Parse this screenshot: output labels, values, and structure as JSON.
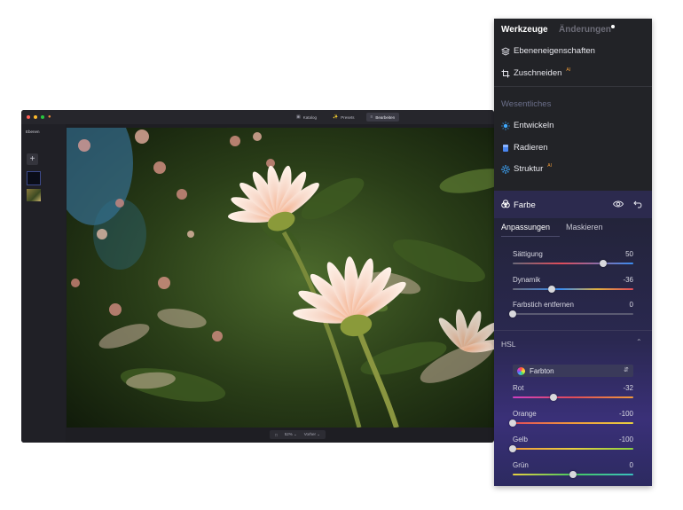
{
  "app": {
    "traffic_colors": [
      "#ff5f57",
      "#febc2e",
      "#28c840"
    ],
    "top_tabs": [
      {
        "label": "Katalog",
        "active": false
      },
      {
        "label": "Presets",
        "active": false
      },
      {
        "label": "Bearbeiten",
        "active": true
      }
    ],
    "sidebar_label": "Ebenen",
    "add_label": "+",
    "bottom_bar": {
      "zoom": "52% ⌄",
      "view": "Vorher ⌄"
    }
  },
  "panel": {
    "tabs": {
      "tools": "Werkzeuge",
      "changes": "Änderungen"
    },
    "items_top": [
      {
        "label": "Ebeneneigenschaften",
        "icon": "layers-icon",
        "ai": ""
      },
      {
        "label": "Zuschneiden",
        "icon": "crop-icon",
        "ai": "AI"
      }
    ],
    "section_label": "Wesentliches",
    "items_essential": [
      {
        "label": "Entwickeln",
        "icon": "sun-icon",
        "ai": ""
      },
      {
        "label": "Radieren",
        "icon": "eraser-icon",
        "ai": ""
      },
      {
        "label": "Struktur",
        "icon": "structure-icon",
        "ai": "AI"
      }
    ],
    "color_tool": {
      "label": "Farbe",
      "icon": "color-circles-icon"
    },
    "subtabs": {
      "adjust": "Anpassungen",
      "mask": "Maskieren"
    },
    "sliders": [
      {
        "label": "Sättigung",
        "value": "50",
        "fraction": 0.75
      },
      {
        "label": "Dynamik",
        "value": "-36",
        "fraction": 0.32
      },
      {
        "label": "Farbstich entfernen",
        "value": "0",
        "fraction": 0.0
      }
    ],
    "hsl": {
      "label": "HSL",
      "select_value": "Farbton",
      "sliders": [
        {
          "label": "Rot",
          "value": "-32",
          "fraction": 0.34
        },
        {
          "label": "Orange",
          "value": "-100",
          "fraction": 0.0
        },
        {
          "label": "Gelb",
          "value": "-100",
          "fraction": 0.0
        },
        {
          "label": "Grün",
          "value": "0",
          "fraction": 0.5
        }
      ]
    }
  },
  "colors": {
    "accent_ai": "#f29c38",
    "panel_bg": "#222327",
    "active_tool_bg": "#2c2a4e"
  }
}
